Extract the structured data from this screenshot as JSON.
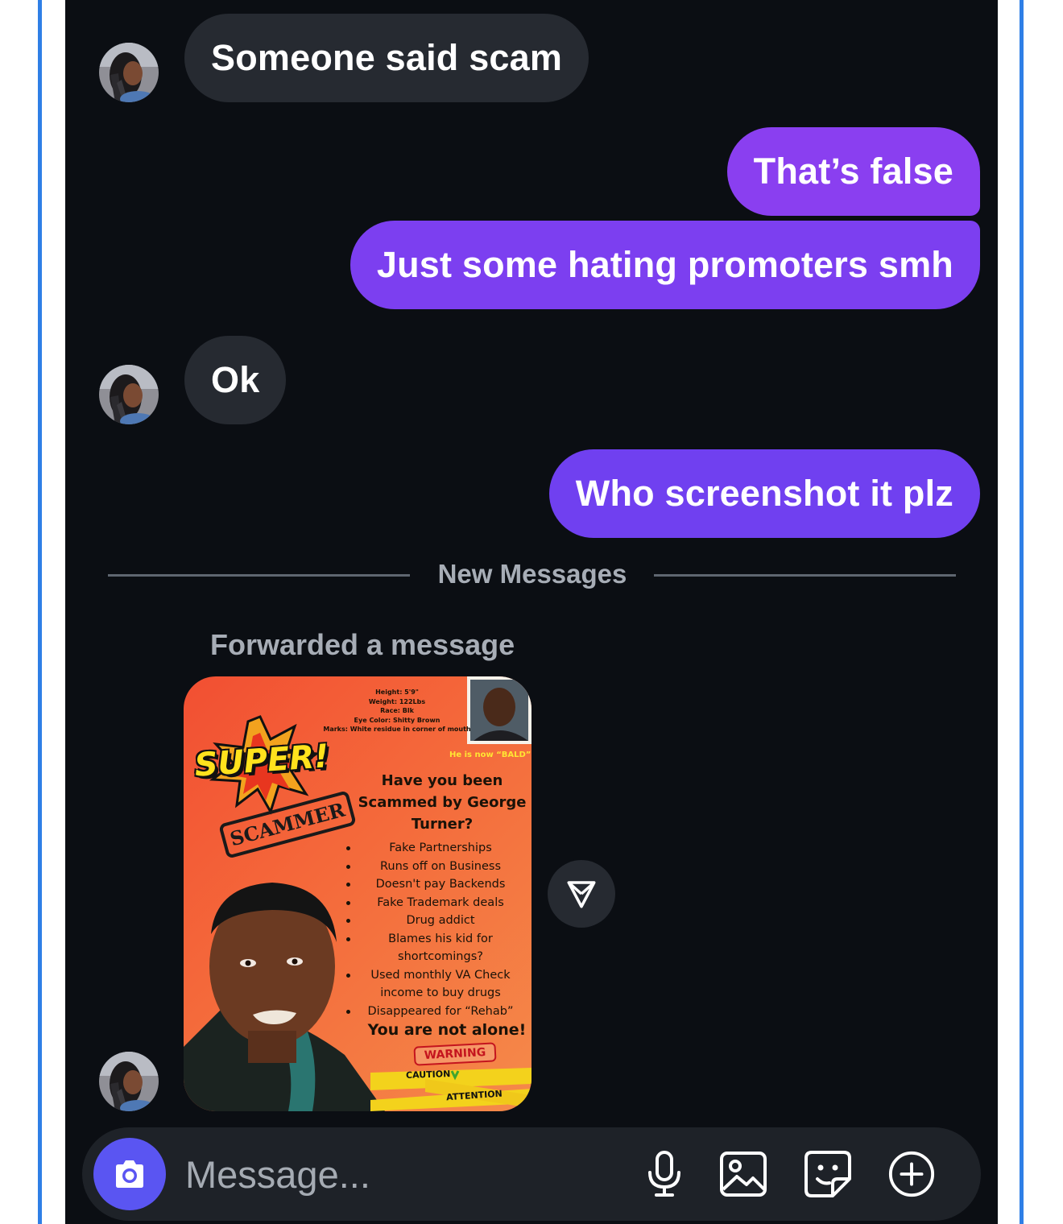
{
  "messages": [
    {
      "sender": "them",
      "text": "Someone said scam"
    },
    {
      "sender": "me",
      "text": "That’s false"
    },
    {
      "sender": "me",
      "text": "Just some hating promoters smh"
    },
    {
      "sender": "them",
      "text": "Ok"
    },
    {
      "sender": "me",
      "text": "Who screenshot it plz"
    }
  ],
  "divider": {
    "label": "New Messages"
  },
  "forwarded": {
    "label": "Forwarded a message",
    "poster": {
      "stats": [
        "Height: 5'9\"",
        "Weight: 122Lbs",
        "Race: Blk",
        "Eye Color: Shitty Brown",
        "Marks: White residue in corner of mouth"
      ],
      "note": "He is now “BALD”",
      "badge": "SUPER!",
      "stamp": "SCAMMER",
      "headline": "Have you been Scammed by George Turner?",
      "bullets": [
        "Fake Partnerships",
        "Runs off on Business",
        "Doesn't pay Backends",
        "Fake Trademark deals",
        "Drug addict",
        "Blames his kid for shortcomings?",
        "Used monthly VA Check income to buy drugs",
        "Disappeared for “Rehab”"
      ],
      "closing": "You are not alone!",
      "warning": "WARNING",
      "tape": [
        "CAUTION",
        "ATTENTION"
      ]
    }
  },
  "composer": {
    "placeholder": "Message..."
  },
  "colors": {
    "accent": "#7b3fee",
    "camera": "#5a55f2",
    "incoming_bubble": "#262a31",
    "background": "#0b0e13"
  },
  "icons": [
    "camera-icon",
    "microphone-icon",
    "gallery-icon",
    "sticker-icon",
    "add-icon",
    "share-icon"
  ]
}
